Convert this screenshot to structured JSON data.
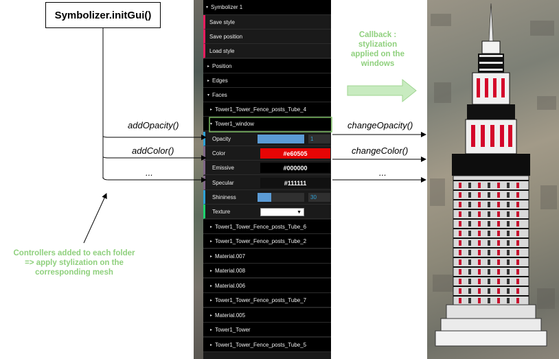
{
  "diagram": {
    "title": "Symbolizer.initGui()",
    "left_calls": [
      "addOpacity()",
      "addColor()",
      "..."
    ],
    "right_calls": [
      "changeOpacity()",
      "changeColor()",
      "..."
    ],
    "callback_text": [
      "Callback :",
      "stylization",
      "applied on the",
      "windows"
    ],
    "controllers_text": [
      "Controllers added to each folder",
      "=> apply stylization on the",
      "corresponding mesh"
    ],
    "colors": {
      "green": "#8fd07d",
      "arrow": "#000000"
    }
  },
  "gui": {
    "root_title": "Symbolizer 1",
    "buttons": [
      "Save style",
      "Save position",
      "Load style"
    ],
    "folders_top": [
      "Position",
      "Edges",
      "Faces"
    ],
    "mesh_first": "Tower1_Tower_Fence_posts_Tube_4",
    "open_folder": "Tower1_window",
    "controls": {
      "opacity": {
        "label": "Opacity",
        "value": "1",
        "fill": 1.0
      },
      "color": {
        "label": "Color",
        "value": "#e60505",
        "bg": "#e60505"
      },
      "emissive": {
        "label": "Emissive",
        "value": "#000000",
        "bg": "#000000"
      },
      "specular": {
        "label": "Specular",
        "value": "#111111",
        "bg": "#111111"
      },
      "shininess": {
        "label": "Shininess",
        "value": "30",
        "fill": 0.3
      },
      "texture": {
        "label": "Texture",
        "value": ""
      }
    },
    "mesh_rest": [
      "Tower1_Tower_Fence_posts_Tube_6",
      "Tower1_Tower_Fence_posts_Tube_2",
      "Material.007",
      "Material.008",
      "Material.006",
      "Tower1_Tower_Fence_posts_Tube_7",
      "Material.005",
      "Tower1_Tower",
      "Tower1_Tower_Fence_posts_Tube_5"
    ]
  }
}
